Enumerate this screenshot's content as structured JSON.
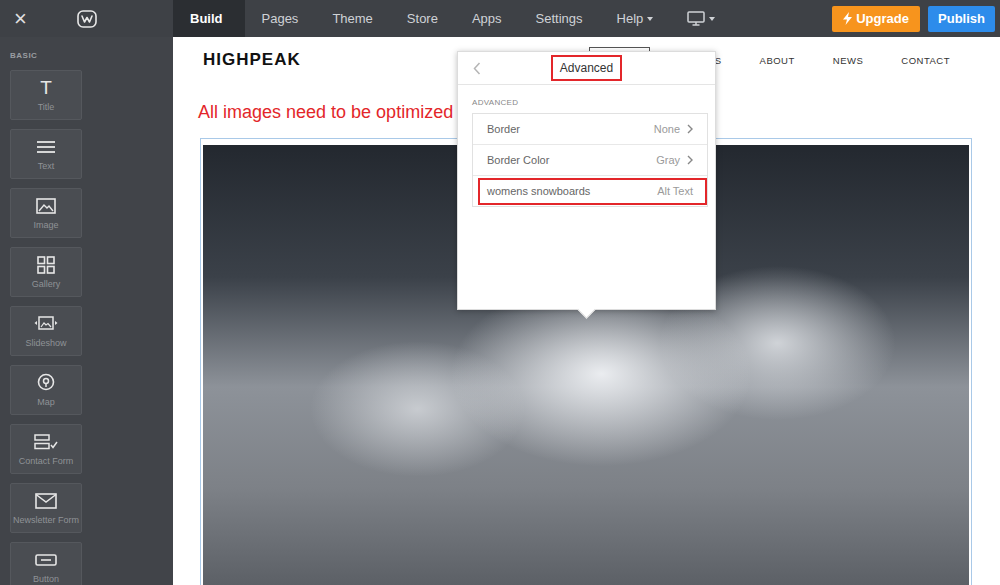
{
  "toolbar": {
    "close": "×",
    "tabs": [
      {
        "label": "Build",
        "selected": true,
        "dropdown": false
      },
      {
        "label": "Pages",
        "selected": false,
        "dropdown": false
      },
      {
        "label": "Theme",
        "selected": false,
        "dropdown": false
      },
      {
        "label": "Store",
        "selected": false,
        "dropdown": false
      },
      {
        "label": "Apps",
        "selected": false,
        "dropdown": false
      },
      {
        "label": "Settings",
        "selected": false,
        "dropdown": false
      },
      {
        "label": "Help",
        "selected": false,
        "dropdown": true
      }
    ],
    "device": {
      "dropdown": true
    },
    "buttons": [
      {
        "label": "Upgrade",
        "kind": "upgrade"
      },
      {
        "label": "Publish",
        "kind": "publish"
      }
    ]
  },
  "sidebar": {
    "section": "BASIC",
    "items": [
      {
        "label": "Title",
        "kind": "glyph",
        "glyph": "T"
      },
      {
        "label": "Text",
        "kind": "text"
      },
      {
        "label": "Image",
        "kind": "image"
      },
      {
        "label": "Gallery",
        "kind": "gallery"
      },
      {
        "label": "Slideshow",
        "kind": "slideshow"
      },
      {
        "label": "Map",
        "kind": "map"
      },
      {
        "label": "Contact Form",
        "kind": "form"
      },
      {
        "label": "Newsletter Form",
        "kind": "newsletter"
      },
      {
        "label": "Button",
        "kind": "button"
      }
    ]
  },
  "site": {
    "logo": "HIGHPEAK",
    "nav": [
      {
        "label": "",
        "selected": true
      },
      {
        "label": "ES",
        "selected": false
      },
      {
        "label": "ABOUT",
        "selected": false
      },
      {
        "label": "NEWS",
        "selected": false
      },
      {
        "label": "CONTACT",
        "selected": false
      }
    ]
  },
  "annotation": "All images need to be optimized",
  "image": {
    "selected": true
  },
  "popover": {
    "title": "Advanced",
    "title_highlighted": true,
    "section": "ADVANCED",
    "rows": [
      {
        "label": "Border",
        "value": "None",
        "kind": "select",
        "highlighted": false
      },
      {
        "label": "Border Color",
        "value": "Gray",
        "kind": "select",
        "highlighted": false
      },
      {
        "label": "womens snowboards",
        "value": "Alt Text",
        "kind": "input",
        "highlighted": true
      }
    ]
  }
}
